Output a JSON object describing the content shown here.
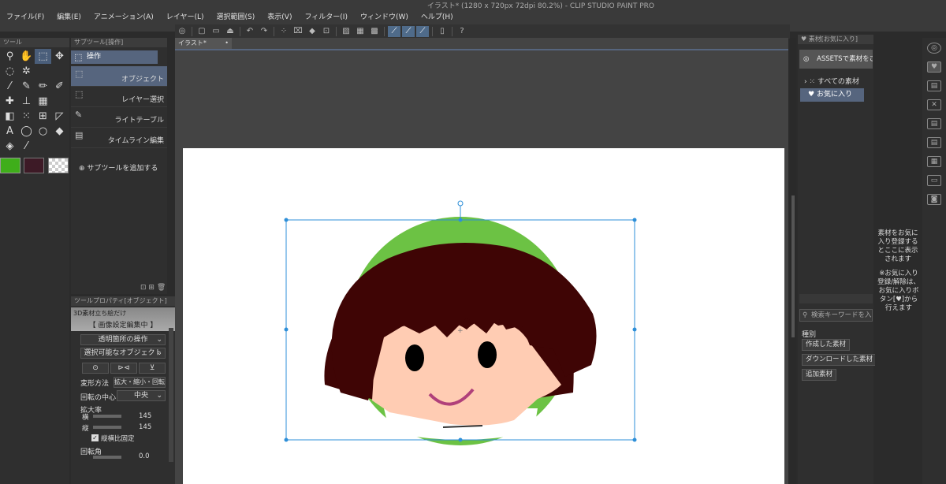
{
  "window": {
    "title": "イラスト* (1280 x 720px 72dpi 80.2%) - CLIP STUDIO PAINT PRO"
  },
  "menu": [
    "ファイル(F)",
    "編集(E)",
    "アニメーション(A)",
    "レイヤー(L)",
    "選択範囲(S)",
    "表示(V)",
    "フィルター(I)",
    "ウィンドウ(W)",
    "ヘルプ(H)"
  ],
  "tool_panel": {
    "title": "ツール",
    "colors": {
      "main": "#3fae1a",
      "sub": "#3d1a26"
    }
  },
  "subtool_panel": {
    "title": "サブツール[操作]",
    "group": "操作",
    "items": [
      "オブジェクト",
      "レイヤー選択",
      "ライトテーブル",
      "タイムライン編集"
    ],
    "add_label": "サブツールを追加する"
  },
  "tool_property": {
    "title": "ツールプロパティ[オブジェクト]",
    "banner": "3D素材立ち絵だけ",
    "editing": "【 画像設定編集中 】",
    "transparent_op": "透明箇所の操作",
    "selectable": "選択可能なオブジェクト",
    "transform_label": "変形方法",
    "transform_value": "拡大・縮小・回転",
    "center_label": "回転の中心",
    "center_value": "中央",
    "scale_label": "拡大率",
    "width_label": "横",
    "width_value": "145",
    "height_label": "縦",
    "height_value": "145",
    "keep_ratio": "縦横比固定",
    "rotate_label": "回転角",
    "rotate_value": "0.0"
  },
  "canvas": {
    "tab": "イラスト*"
  },
  "material_panel": {
    "title": "素材[お気に入り]",
    "assets_button": "ASSETSで素材をさがす",
    "all": "すべての素材",
    "favorites": "お気に入り",
    "search_placeholder": "検索キーワードを入...",
    "kind_label": "種別",
    "filters": [
      "作成した素材",
      "ダウンロードした素材",
      "追加素材"
    ],
    "hint": "素材をお気に入り登録するとここに表示されます",
    "note": "※お気に入り登録/解除は、お気に入りボタン[♥]から行えます"
  }
}
